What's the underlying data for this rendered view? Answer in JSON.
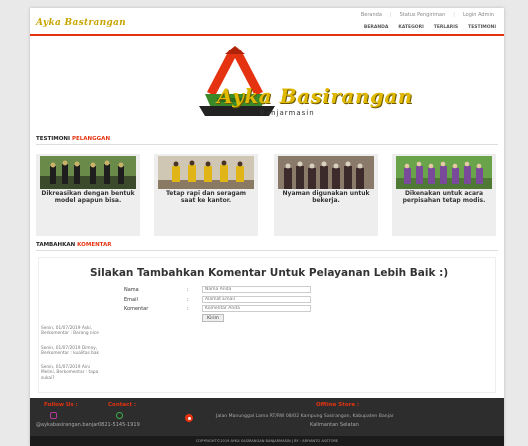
{
  "header": {
    "logo_text": "Ayka Bastrangan",
    "topnav": [
      "Beranda",
      "Status Pengiriman",
      "Login Admin"
    ],
    "mainnav": [
      "BERANDA",
      "KATEGORI",
      "TERLARIS",
      "TESTIMONI"
    ],
    "accent_color": "#e53311"
  },
  "hero": {
    "title": "Ayka Basirangan",
    "subtitle": "Banjarmasin"
  },
  "testimoni": {
    "heading_main": "TESTIMONI",
    "heading_hl": "PELANGGAN",
    "items": [
      {
        "caption": "Dikreasikan dengan bentuk model apapun bisa."
      },
      {
        "caption": "Tetap rapi dan seragam saat ke kantor."
      },
      {
        "caption": "Nyaman digunakan untuk bekerja."
      },
      {
        "caption": "Dikenakan untuk acara perpisahan tetap modis."
      }
    ]
  },
  "komentar": {
    "heading_main": "TAMBAHKAN",
    "heading_hl": "KOMENTAR",
    "form_title": "Silakan Tambahkan Komentar Untuk Pelayanan Lebih Baik :)",
    "fields": [
      {
        "label": "Nama",
        "placeholder": "Nama Anda"
      },
      {
        "label": "Email",
        "placeholder": "Alamat Email"
      },
      {
        "label": "Komentar",
        "placeholder": "Komentar Anda"
      }
    ],
    "submit_label": "Kirim",
    "comments": [
      {
        "text": "Senin, 01/07/2019 Aski, Berkomentar : Barang nice"
      },
      {
        "text": "Senin, 01/07/2019 Dimny, Berkomentar : kualitas bak"
      },
      {
        "text": "Senin, 01/07/2019 Aini Melini, Berkomentar : tapa sukai?"
      }
    ]
  },
  "footer": {
    "follow_heading": "Follow Us :",
    "follow_text": "@aykabasirangan.banjar",
    "contact_heading": "Contact :",
    "contact_text": "0821-5145-1919",
    "store_heading": "Offline Store :",
    "store_text_line1": "Jalan Manunggal Lama RT/RW 08/02 Kampung Sasirangan, Kabupaten Banjar",
    "store_text_line2": "Kalimantan Selatan",
    "copyright": "COPYRIGHT©2019 AYKA SASIRANGAN BANJARMASIN | BY : ARIYANTO ASSTORE"
  }
}
